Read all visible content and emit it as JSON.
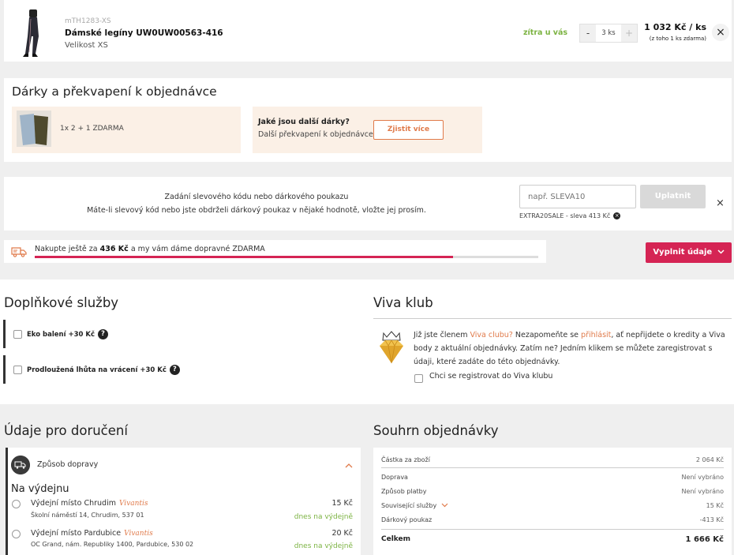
{
  "product": {
    "sku": "mTH1283-XS",
    "name": "Dámské legíny UW0UW00563-416",
    "size": "Velikost XS",
    "delivery": "zítra u vás",
    "qty_minus": "-",
    "qty_value": "3 ks",
    "qty_plus": "+",
    "price": "1 032 Kč / ks",
    "price_note": "(z toho 1 ks zdarma)",
    "remove": "×"
  },
  "gifts": {
    "title": "Dárky a překvapení k objednávce",
    "offer_label": "1x 2 + 1 ZDARMA",
    "more_question": "Jaké jsou další dárky?",
    "more_sub": "Další překvapení k objednávce",
    "more_button": "Zjistit více"
  },
  "discount": {
    "line1": "Zadání slevového kódu nebo dárkového poukazu",
    "line2": "Máte-li slevový kód nebo jste obdrželi dárkový poukaz v nějaké hodnotě, vložte jej prosím.",
    "placeholder": "např. SLEVA10",
    "apply_button": "Uplatnit",
    "applied": "EXTRA20SALE - sleva 413 Kč",
    "close": "×"
  },
  "shipping": {
    "text_prefix": "Nakupte ještě za",
    "amount": "436 Kč",
    "text_suffix": "a my vám dáme dopravné ZDARMA",
    "progress": 0.83,
    "fill_button": "Vyplnit údaje"
  },
  "services": {
    "title": "Doplňkové služby",
    "items": [
      {
        "label": "Eko balení  +30 Kč"
      },
      {
        "label": "Prodloužená lhůta na vrácení  +30 Kč"
      }
    ]
  },
  "viva": {
    "title": "Viva klub",
    "text_a": "Již jste členem ",
    "text_link1": "Viva clubu?",
    "text_b": " Nezapomeňte se ",
    "text_link2": "přihlásit",
    "text_c": ", ať nepřijdete o kredity a Viva body z aktuální objednávky. Zatím ne? Jedním klikem se můžete zaregistrovat s údaji, které zadáte do této objednávky.",
    "register_label": "Chci se registrovat do Viva klubu"
  },
  "delivery": {
    "title": "Údaje pro doručení",
    "method_label": "Způsob dopravy",
    "subtitle": "Na výdejnu",
    "places": [
      {
        "name": "Výdejní místo Chrudim",
        "brand": "Vivantis",
        "address": "Školní náměstí 14, Chrudim, 537 01",
        "price": "15 Kč",
        "availability": "dnes na výdejně"
      },
      {
        "name": "Výdejní místo Pardubice",
        "brand": "Vivantis",
        "address": "OC Grand, nám. Republiky 1400, Pardubice, 530 02",
        "price": "20 Kč",
        "availability": "dnes na výdejně"
      }
    ]
  },
  "summary": {
    "title": "Souhrn objednávky",
    "rows": [
      {
        "label": "Částka za zboží",
        "value": "2 064 Kč"
      },
      {
        "label": "Doprava",
        "value": "Není vybráno"
      },
      {
        "label": "Způsob platby",
        "value": "Není vybráno"
      },
      {
        "label": "Související služby",
        "value": "15 Kč"
      },
      {
        "label": "Dárkový poukaz",
        "value": "-413 Kč"
      }
    ],
    "total_label": "Celkem",
    "total_value": "1 666 Kč"
  },
  "colors": {
    "accent": "#d52454",
    "orange": "#e07a4a",
    "green": "#7cb342",
    "peach": "#fbf0e6"
  }
}
